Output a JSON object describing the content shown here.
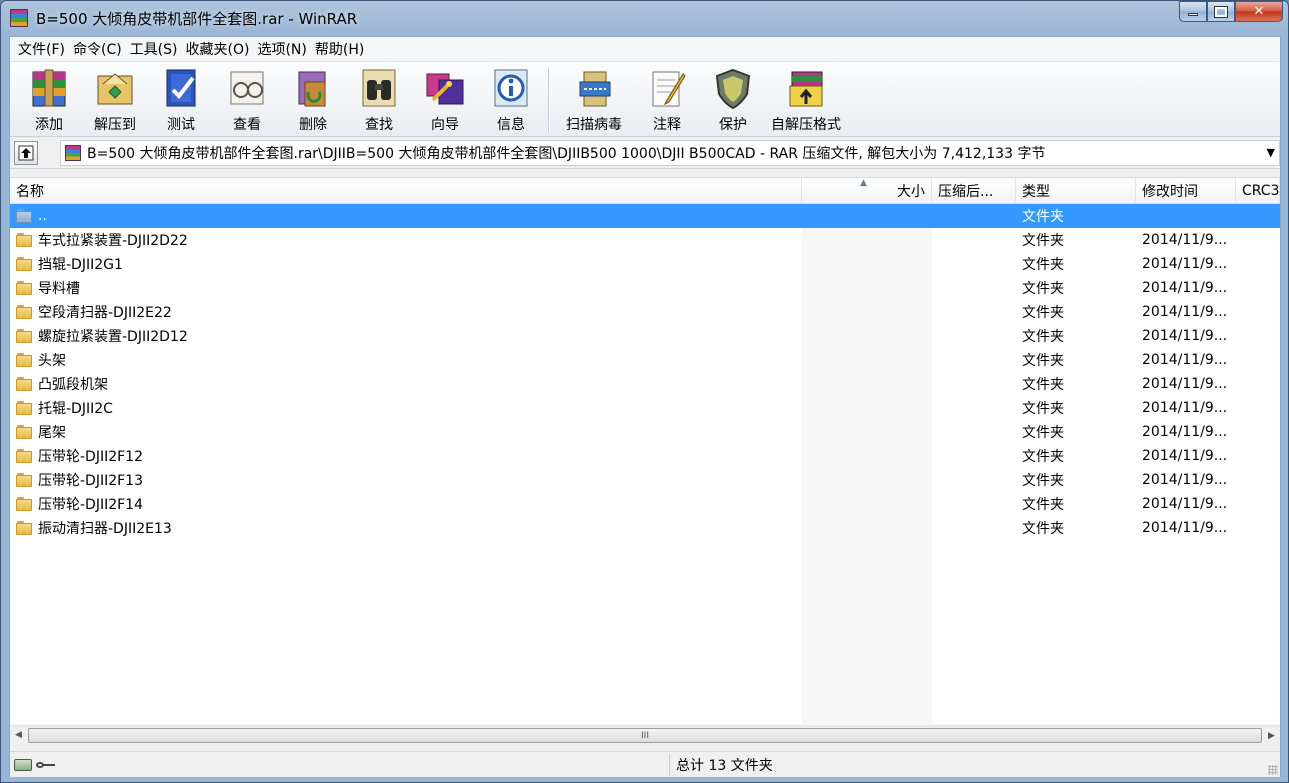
{
  "window": {
    "title": "B=500 大倾角皮带机部件全套图.rar - WinRAR"
  },
  "menu": {
    "items": [
      "文件(F)",
      "命令(C)",
      "工具(S)",
      "收藏夹(O)",
      "选项(N)",
      "帮助(H)"
    ]
  },
  "toolbar": {
    "buttons": [
      {
        "label": "添加",
        "icon": "add-archive-icon"
      },
      {
        "label": "解压到",
        "icon": "extract-to-icon"
      },
      {
        "label": "测试",
        "icon": "test-icon"
      },
      {
        "label": "查看",
        "icon": "view-icon"
      },
      {
        "label": "删除",
        "icon": "delete-icon"
      },
      {
        "label": "查找",
        "icon": "find-icon"
      },
      {
        "label": "向导",
        "icon": "wizard-icon"
      },
      {
        "label": "信息",
        "icon": "info-icon"
      },
      {
        "label": "扫描病毒",
        "icon": "virus-scan-icon"
      },
      {
        "label": "注释",
        "icon": "comment-icon"
      },
      {
        "label": "保护",
        "icon": "protect-icon"
      },
      {
        "label": "自解压格式",
        "icon": "sfx-icon"
      }
    ]
  },
  "address": {
    "path": "B=500 大倾角皮带机部件全套图.rar\\DJIIB=500 大倾角皮带机部件全套图\\DJIIB500 1000\\DJII B500CAD - RAR 压缩文件, 解包大小为 7,412,133 字节"
  },
  "columns": {
    "name": "名称",
    "size": "大小",
    "packed": "压缩后...",
    "type": "类型",
    "mtime": "修改时间",
    "crc": "CRC3"
  },
  "rows": [
    {
      "name": "..",
      "type": "文件夹",
      "mtime": "",
      "selected": true,
      "up": true
    },
    {
      "name": "车式拉紧装置-DJII2D22",
      "type": "文件夹",
      "mtime": "2014/11/9..."
    },
    {
      "name": "挡辊-DJII2G1",
      "type": "文件夹",
      "mtime": "2014/11/9..."
    },
    {
      "name": "导料槽",
      "type": "文件夹",
      "mtime": "2014/11/9..."
    },
    {
      "name": "空段清扫器-DJII2E22",
      "type": "文件夹",
      "mtime": "2014/11/9..."
    },
    {
      "name": "螺旋拉紧装置-DJII2D12",
      "type": "文件夹",
      "mtime": "2014/11/9..."
    },
    {
      "name": "头架",
      "type": "文件夹",
      "mtime": "2014/11/9..."
    },
    {
      "name": "凸弧段机架",
      "type": "文件夹",
      "mtime": "2014/11/9..."
    },
    {
      "name": "托辊-DJII2C",
      "type": "文件夹",
      "mtime": "2014/11/9..."
    },
    {
      "name": "尾架",
      "type": "文件夹",
      "mtime": "2014/11/9..."
    },
    {
      "name": "压带轮-DJII2F12",
      "type": "文件夹",
      "mtime": "2014/11/9..."
    },
    {
      "name": "压带轮-DJII2F13",
      "type": "文件夹",
      "mtime": "2014/11/9..."
    },
    {
      "name": "压带轮-DJII2F14",
      "type": "文件夹",
      "mtime": "2014/11/9..."
    },
    {
      "name": "振动清扫器-DJII2E13",
      "type": "文件夹",
      "mtime": "2014/11/9..."
    }
  ],
  "status": {
    "text": "总计 13 文件夹"
  },
  "scrollbar": {
    "thumb_grip": "III"
  }
}
